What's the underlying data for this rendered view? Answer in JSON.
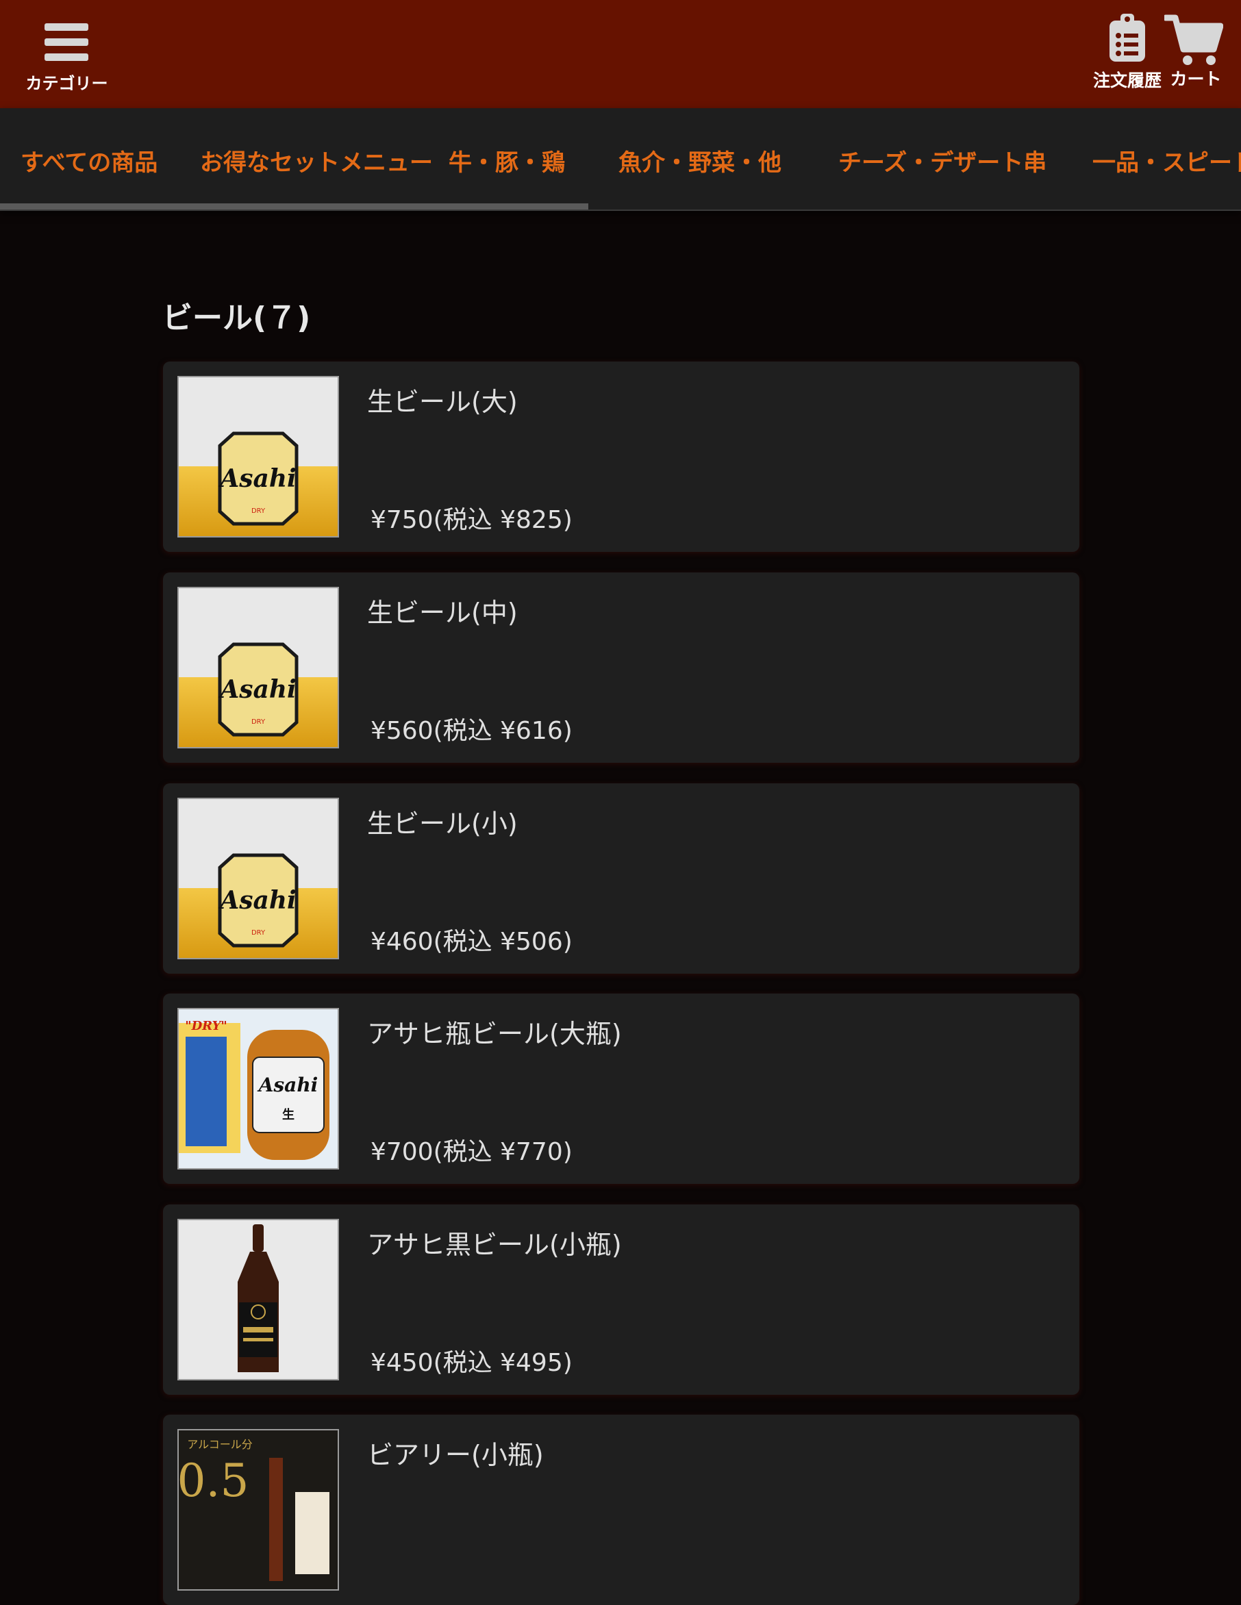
{
  "header": {
    "menu_label": "カテゴリー",
    "history_label": "注文履歴",
    "cart_label": "カート",
    "bg_color": "#661200"
  },
  "tabs": [
    {
      "label": "すべての商品",
      "active": true
    },
    {
      "label": "お得なセットメニュー",
      "active": false
    },
    {
      "label": "牛・豚・鶏",
      "active": false
    },
    {
      "label": "魚介・野菜・他",
      "active": false
    },
    {
      "label": "チーズ・デザート串",
      "active": false
    },
    {
      "label": "一品・スピード",
      "active": false
    }
  ],
  "tab_color": "#e46a16",
  "section": {
    "title": "ビール(７)"
  },
  "items": [
    {
      "name": "生ビール(大)",
      "price": "¥750(税込 ¥825)",
      "image": "draft-beer-glass"
    },
    {
      "name": "生ビール(中)",
      "price": "¥560(税込 ¥616)",
      "image": "draft-beer-glass"
    },
    {
      "name": "生ビール(小)",
      "price": "¥460(税込 ¥506)",
      "image": "draft-beer-glass"
    },
    {
      "name": "アサヒ瓶ビール(大瓶)",
      "price": "¥700(税込 ¥770)",
      "image": "asahi-bottle-poster"
    },
    {
      "name": "アサヒ黒ビール(小瓶)",
      "price": "¥450(税込 ¥495)",
      "image": "black-beer-bottle"
    },
    {
      "name": "ビアリー(小瓶)",
      "price": "",
      "image": "beery-bottle"
    }
  ]
}
